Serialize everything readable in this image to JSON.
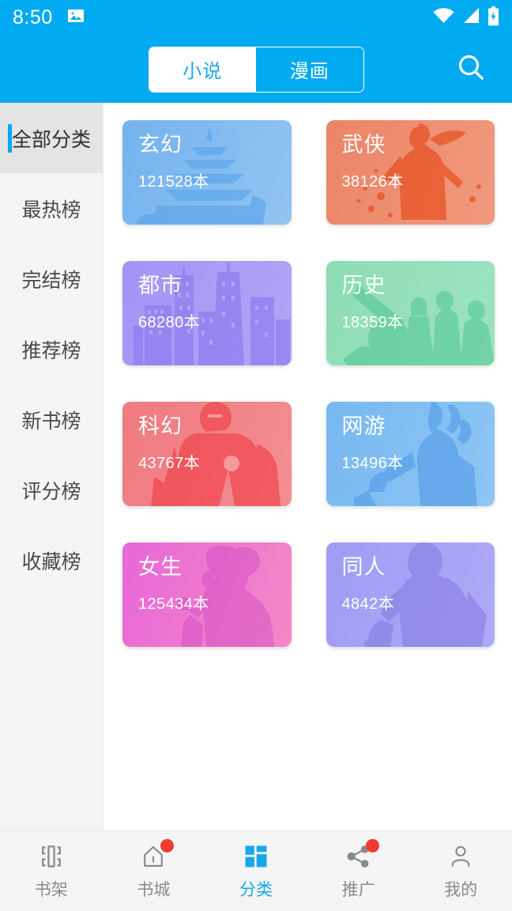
{
  "status_bar": {
    "time": "8:50",
    "icons": [
      "image-notification-icon",
      "wifi-icon",
      "signal-icon",
      "battery-charging-icon"
    ]
  },
  "header": {
    "segments": [
      {
        "label": "小说",
        "active": true
      },
      {
        "label": "漫画",
        "active": false
      }
    ],
    "search_icon": "search-icon",
    "background_color": "#00AAF0"
  },
  "sidebar": {
    "items": [
      {
        "label": "全部分类",
        "active": true
      },
      {
        "label": "最热榜",
        "active": false
      },
      {
        "label": "完结榜",
        "active": false
      },
      {
        "label": "推荐榜",
        "active": false
      },
      {
        "label": "新书榜",
        "active": false
      },
      {
        "label": "评分榜",
        "active": false
      },
      {
        "label": "收藏榜",
        "active": false
      }
    ],
    "active_indicator_color": "#00AAF0",
    "background_color": "#f5f5f5"
  },
  "categories": [
    {
      "name": "玄幻",
      "count": "121528本",
      "color": "#74b3ee",
      "color_end": "#92c4f2",
      "art": "pagoda"
    },
    {
      "name": "武侠",
      "count": "38126本",
      "color": "#ec8466",
      "color_end": "#f09a7e",
      "art": "warrior"
    },
    {
      "name": "都市",
      "count": "68280本",
      "color": "#a493f5",
      "color_end": "#b3a5f7",
      "art": "city"
    },
    {
      "name": "历史",
      "count": "18359本",
      "color": "#8ddcb4",
      "color_end": "#9ee3c2",
      "art": "cannon"
    },
    {
      "name": "科幻",
      "count": "43767本",
      "color": "#ef7a80",
      "color_end": "#f28e93",
      "art": "armor"
    },
    {
      "name": "网游",
      "count": "13496本",
      "color": "#77b8f0",
      "color_end": "#8ec6f4",
      "art": "gamer"
    },
    {
      "name": "女生",
      "count": "125434本",
      "color": "#e867d8",
      "color_end": "#f489c5",
      "art": "girl"
    },
    {
      "name": "同人",
      "count": "4842本",
      "color": "#9e9cf4",
      "color_end": "#afaaf8",
      "art": "anime"
    }
  ],
  "bottom_nav": {
    "items": [
      {
        "label": "书架",
        "icon": "bookshelf-icon",
        "active": false,
        "badge": false
      },
      {
        "label": "书城",
        "icon": "home-icon",
        "active": false,
        "badge": true
      },
      {
        "label": "分类",
        "icon": "grid-icon",
        "active": true,
        "badge": false
      },
      {
        "label": "推广",
        "icon": "share-icon",
        "active": false,
        "badge": true
      },
      {
        "label": "我的",
        "icon": "person-icon",
        "active": false,
        "badge": false
      }
    ],
    "active_color": "#17a8ec",
    "badge_color": "#ef3b2d"
  }
}
